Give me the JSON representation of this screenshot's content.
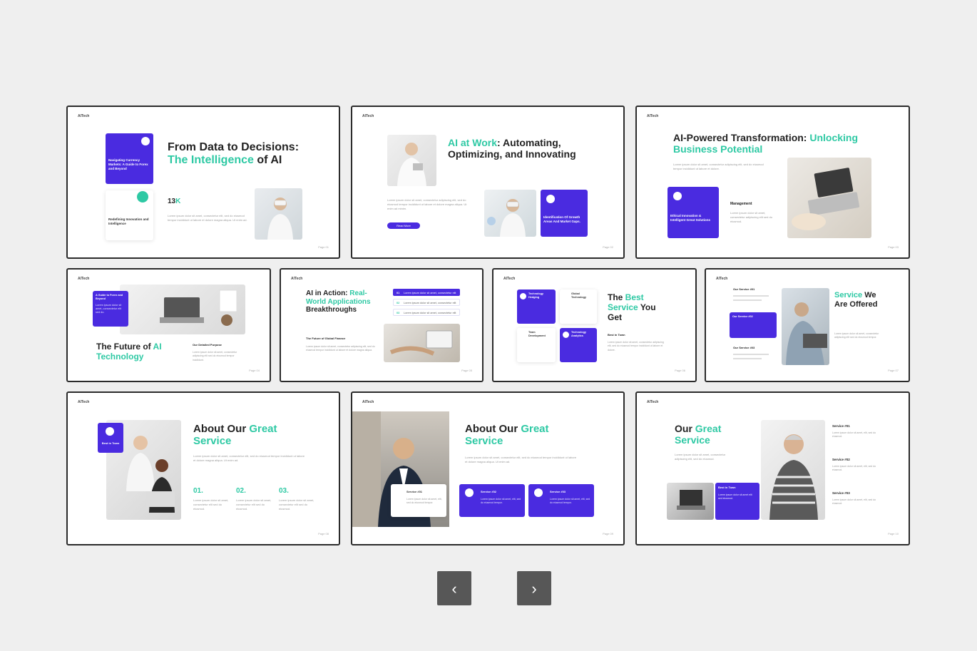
{
  "slides": [
    {
      "brand": "AITech",
      "title_a": "From Data to Decisions:",
      "title_b": "The Intelligence",
      "title_c": " of AI",
      "card": "Navigating Currency Markets: A Guide to Forex and Beyond",
      "card2": "Redefining Innovation and Intelligence",
      "stat": "13",
      "stat_k": "K",
      "body": "Lorem ipsum dolor sit amet, consectetur elit, sed do eiusmod tempor incididunt ut labore et dolore magna aliqua. Ut enim ad.",
      "page": "Page 01"
    },
    {
      "brand": "AITech",
      "title_acc": "AI at Work",
      "title_rest": ": Automating, Optimizing, and Innovating",
      "body": "Lorem ipsum dolor sit amet, consectetur adipiscing elit, sed do eiusmod tempor incididunt ut labore et dolore magna aliqua. Ut enim ad minim.",
      "read_more": "Read More",
      "card": "Identification Of Growth Areas And Market Gaps.",
      "page": "Page 02"
    },
    {
      "brand": "AITech",
      "title_a": "AI-Powered Transformation: ",
      "title_acc": "Unlocking Business Potential",
      "body": "Lorem ipsum dolor sit amet, consectetur adipiscing elit, sed do eiusmod tempor incididunt ut labore et dolore.",
      "card": "Ethical Innovation & Intelligent Great Solutions",
      "mgmt": "Management",
      "mgmt_body": "Lorem ipsum dolor sit amet, consectetur adipiscing elit sed do eiusmod.",
      "page": "Page 03"
    },
    {
      "brand": "AITech",
      "title_a": "The Future of ",
      "title_acc": "AI",
      "title_b": "Technology",
      "card": "A Guide to Forex and Beyond",
      "card_body": "Lorem ipsum dolor sit amet, consectetur elit sed do.",
      "purpose": "Our Detailed Purpose",
      "purpose_body": "Lorem ipsum dolor sit amet, consectetur adipiscing elit sed do eiusmod tempor incididunt.",
      "page": "Page 04"
    },
    {
      "brand": "AITech",
      "title_a": "AI in Action: ",
      "title_acc": "Real-World Applications",
      "title_b": "Breakthroughs",
      "rows": [
        {
          "n": "01",
          "t": "Lorem ipsum dolor sit amet, consectetur elit"
        },
        {
          "n": "02",
          "t": "Lorem ipsum dolor sit amet, consectetur elit"
        },
        {
          "n": "03",
          "t": "Lorem ipsum dolor sit amet, consectetur elit"
        }
      ],
      "sub": "The Future of Global Finance",
      "body": "Lorem ipsum dolor sit amet, consectetur adipiscing elit, sed do eiusmod tempor incididunt ut labore et dolore magna aliqua.",
      "page": "Page 05"
    },
    {
      "brand": "AITech",
      "cards": [
        "Technology Hedging",
        "Global Technology",
        "Team Development",
        "Technology Analytics"
      ],
      "title_a": "The ",
      "title_acc1": "Best",
      "title_acc2": "Service",
      "title_b": " You",
      "title_c": "Get",
      "sub": "Best in Town",
      "body": "Lorem ipsum dolor sit amet, consectetur adipiscing elit, sed do eiusmod tempor incididunt ut labore et dolore.",
      "page": "Page 06"
    },
    {
      "brand": "AITech",
      "s1": "Our Service #01",
      "s2": "Our Service #02",
      "s3": "Our Service #03",
      "title_acc": "Service",
      "title_b": " We",
      "title_c": "Are Offered",
      "body": "Lorem ipsum dolor sit amet, consectetur adipiscing elit sed do eiusmod tempor.",
      "page": "Page 07"
    },
    {
      "brand": "AITech",
      "badge": "Best in Town",
      "title_a": "About Our ",
      "title_acc": "Great",
      "title_acc2": "Service",
      "body": "Lorem ipsum dolor sit amet, consectetur elit, sed do eiusmod tempor incididunt ut labore et dolore magna aliqua. Ut enim ad.",
      "n1": "01.",
      "n2": "02.",
      "n3": "03.",
      "cols": "Lorem ipsum dolor sit amet, consectetur elit sed do eiusmod.",
      "page": "Page 08"
    },
    {
      "brand": "AITech",
      "title_a": "About Our ",
      "title_acc": "Great",
      "title_acc2": "Service",
      "body": "Lorem ipsum dolor sit amet, consectetur elit, sed do eiusmod tempor incididunt ut labore et dolore magna aliqua. Ut enim ad.",
      "svc1": "Service #01",
      "svc2": "Service #02",
      "svc3": "Service #03",
      "svc_body": "Lorem ipsum dolor sit amet, elit, sed do eiusmod tempor.",
      "page": "Page 09"
    },
    {
      "brand": "AITech",
      "title_a": "Our ",
      "title_acc": "Great",
      "title_acc2": "Service",
      "body": "Lorem ipsum dolor sit amet, consectetur adipiscing elit, sed do eiusmod.",
      "badge": "Best in Town",
      "badge_body": "Lorem ipsum dolor sit amet elit sed eiusmod.",
      "s1": "Service #01",
      "s2": "Service #02",
      "s3": "Service #03",
      "s_body": "Lorem ipsum dolor sit amet, elit, sed do eiusmod.",
      "page": "Page 10"
    }
  ],
  "nav": {
    "prev": "‹",
    "next": "›"
  },
  "colors": {
    "accent": "#2ec9a4",
    "brand": "#4a2be0",
    "nav_button": "#575757"
  }
}
